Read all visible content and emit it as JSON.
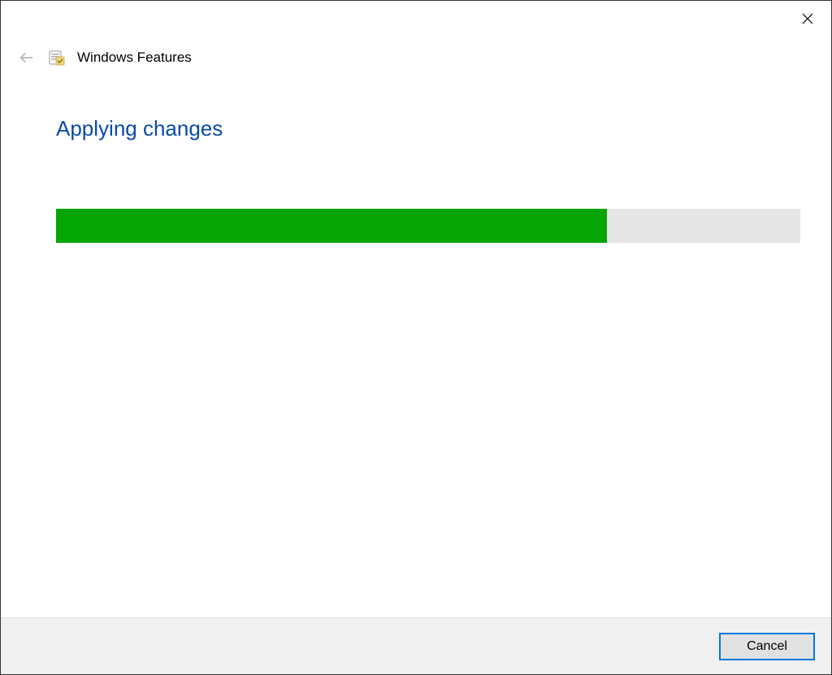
{
  "window": {
    "title": "Windows Features"
  },
  "heading": "Applying changes",
  "progress": {
    "percent": 74
  },
  "footer": {
    "cancel_label": "Cancel"
  }
}
